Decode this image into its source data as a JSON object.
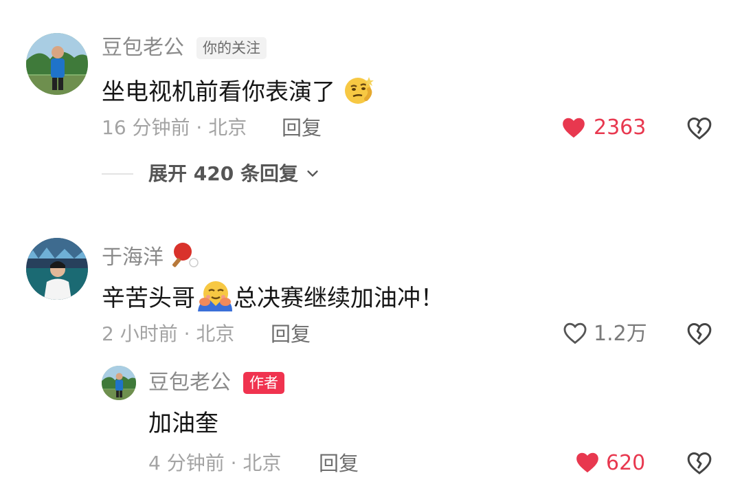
{
  "comments": [
    {
      "username": "豆包老公",
      "tag": "你的关注",
      "text": "坐电视机前看你表演了",
      "emoji": "smirk-thinking-face-emoji",
      "time_location": "16 分钟前 · 北京",
      "reply_label": "回复",
      "like_count": "2363",
      "liked": true,
      "expand_label": "展开 420 条回复"
    },
    {
      "username": "于海洋",
      "username_emoji": "ping-pong-emoji",
      "text_before": "辛苦头哥",
      "emoji": "hugging-face-emoji",
      "text_after": "总决赛继续加油冲！",
      "time_location": "2 小时前 · 北京",
      "reply_label": "回复",
      "like_count": "1.2万",
      "liked": false,
      "reply": {
        "username": "豆包老公",
        "tag": "作者",
        "text": "加油奎",
        "time_location": "4 分钟前 · 北京",
        "reply_label": "回复",
        "like_count": "620",
        "liked": true
      }
    }
  ],
  "colors": {
    "like_active": "#e8384f",
    "author_tag": "#f0334f",
    "username": "#8a8a8a",
    "meta": "#a3a3a3"
  }
}
